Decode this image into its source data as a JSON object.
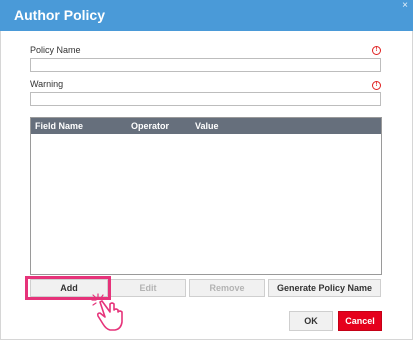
{
  "dialog": {
    "title": "Author Policy",
    "close_glyph": "×"
  },
  "form": {
    "policy_name_label": "Policy Name",
    "policy_name_value": "",
    "warning_label": "Warning",
    "warning_value": "",
    "required_glyph": "!"
  },
  "grid": {
    "columns": [
      "Field Name",
      "Operator",
      "Value"
    ],
    "rows": []
  },
  "buttons": {
    "add": "Add",
    "edit": "Edit",
    "remove": "Remove",
    "generate": "Generate Policy Name",
    "ok": "OK",
    "cancel": "Cancel"
  },
  "colors": {
    "title_bar": "#4a9ad8",
    "grid_header": "#666f7c",
    "required": "#e02020",
    "highlight": "#e6337a",
    "cancel": "#e5001c"
  },
  "icons": {
    "pointer": "hand-pointer-icon"
  }
}
